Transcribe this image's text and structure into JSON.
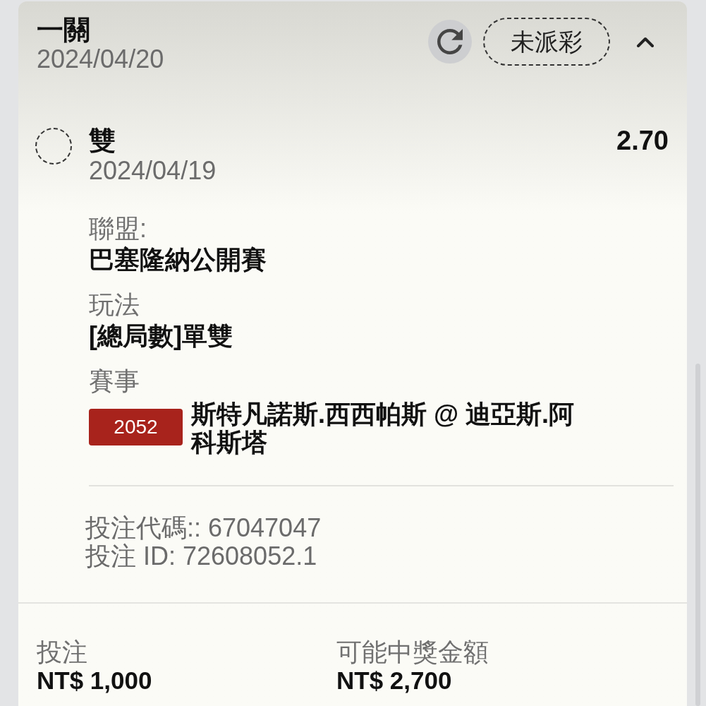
{
  "header": {
    "title": "一關",
    "date": "2024/04/20",
    "status": "未派彩",
    "expanded": true
  },
  "selection": {
    "name": "雙",
    "date": "2024/04/19",
    "odds": "2.70"
  },
  "details": [
    {
      "kind": "text",
      "label": "聯盟:",
      "value": "巴塞隆納公開賽"
    },
    {
      "kind": "text",
      "label": "玩法",
      "value": "[總局數]單雙"
    },
    {
      "kind": "event",
      "label": "賽事",
      "code": "2052",
      "value": "斯特凡諾斯.西西帕斯 @ 迪亞斯.阿科斯塔"
    }
  ],
  "bet_info": [
    "投注代碼:: 67047047",
    "投注 ID: 72608052.1"
  ],
  "totals": [
    {
      "label": "投注",
      "value": "NT$ 1,000"
    },
    {
      "label": "可能中獎金額",
      "value": "NT$ 2,700"
    }
  ]
}
